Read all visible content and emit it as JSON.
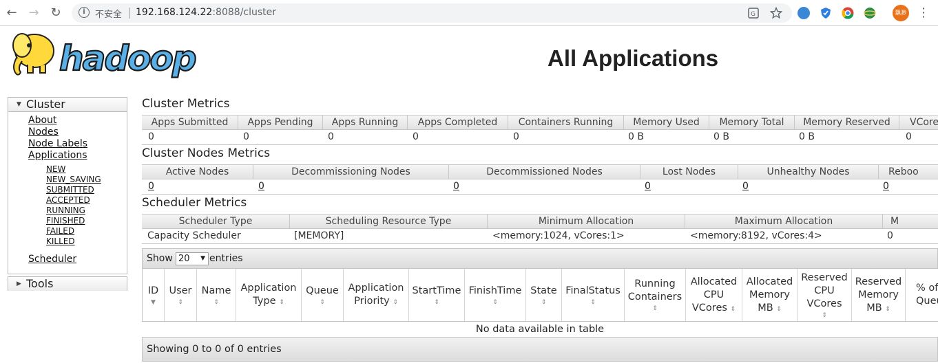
{
  "browser": {
    "insecure_label": "不安全",
    "url_host": "192.168.124.22",
    "url_rest": ":8088/cluster",
    "avatar_text": "飘渺"
  },
  "header": {
    "logo_text": "hadoop",
    "page_title": "All Applications"
  },
  "sidebar": {
    "cluster_label": "Cluster",
    "links": [
      "About",
      "Nodes",
      "Node Labels",
      "Applications"
    ],
    "app_states": [
      "NEW",
      "NEW_SAVING",
      "SUBMITTED",
      "ACCEPTED",
      "RUNNING",
      "FINISHED",
      "FAILED",
      "KILLED"
    ],
    "scheduler_label": "Scheduler",
    "tools_label": "Tools"
  },
  "cluster_metrics": {
    "title": "Cluster Metrics",
    "headers": [
      "Apps Submitted",
      "Apps Pending",
      "Apps Running",
      "Apps Completed",
      "Containers Running",
      "Memory Used",
      "Memory Total",
      "Memory Reserved",
      "VCores"
    ],
    "values": [
      "0",
      "0",
      "0",
      "0",
      "0",
      "0 B",
      "0 B",
      "0 B",
      "0"
    ]
  },
  "nodes_metrics": {
    "title": "Cluster Nodes Metrics",
    "headers": [
      "Active Nodes",
      "Decommissioning Nodes",
      "Decommissioned Nodes",
      "Lost Nodes",
      "Unhealthy Nodes",
      "Reboo"
    ],
    "values": [
      "0",
      "0",
      "0",
      "0",
      "0",
      "0"
    ]
  },
  "scheduler_metrics": {
    "title": "Scheduler Metrics",
    "headers": [
      "Scheduler Type",
      "Scheduling Resource Type",
      "Minimum Allocation",
      "Maximum Allocation",
      "M"
    ],
    "values": [
      "Capacity Scheduler",
      "[MEMORY]",
      "<memory:1024, vCores:1>",
      "<memory:8192, vCores:4>",
      "0"
    ]
  },
  "apps": {
    "show_label": "Show",
    "page_length": "20",
    "entries_label": "entries",
    "columns": [
      [
        "ID"
      ],
      [
        "User"
      ],
      [
        "Name"
      ],
      [
        "Application",
        "Type"
      ],
      [
        "Queue"
      ],
      [
        "Application",
        "Priority"
      ],
      [
        "StartTime"
      ],
      [
        "FinishTime"
      ],
      [
        "State"
      ],
      [
        "FinalStatus"
      ],
      [
        "Running",
        "Containers"
      ],
      [
        "Allocated",
        "CPU",
        "VCores"
      ],
      [
        "Allocated",
        "Memory",
        "MB"
      ],
      [
        "Reserved",
        "CPU",
        "VCores"
      ],
      [
        "Reserved",
        "Memory",
        "MB"
      ],
      [
        "% of",
        "Queue"
      ]
    ],
    "empty_message": "No data available in table",
    "footer_info": "Showing 0 to 0 of 0 entries"
  },
  "colors": {
    "logo_blue": "#5ab0e6",
    "logo_yellow": "#ffd83c",
    "avatar_orange": "#e8711a"
  }
}
